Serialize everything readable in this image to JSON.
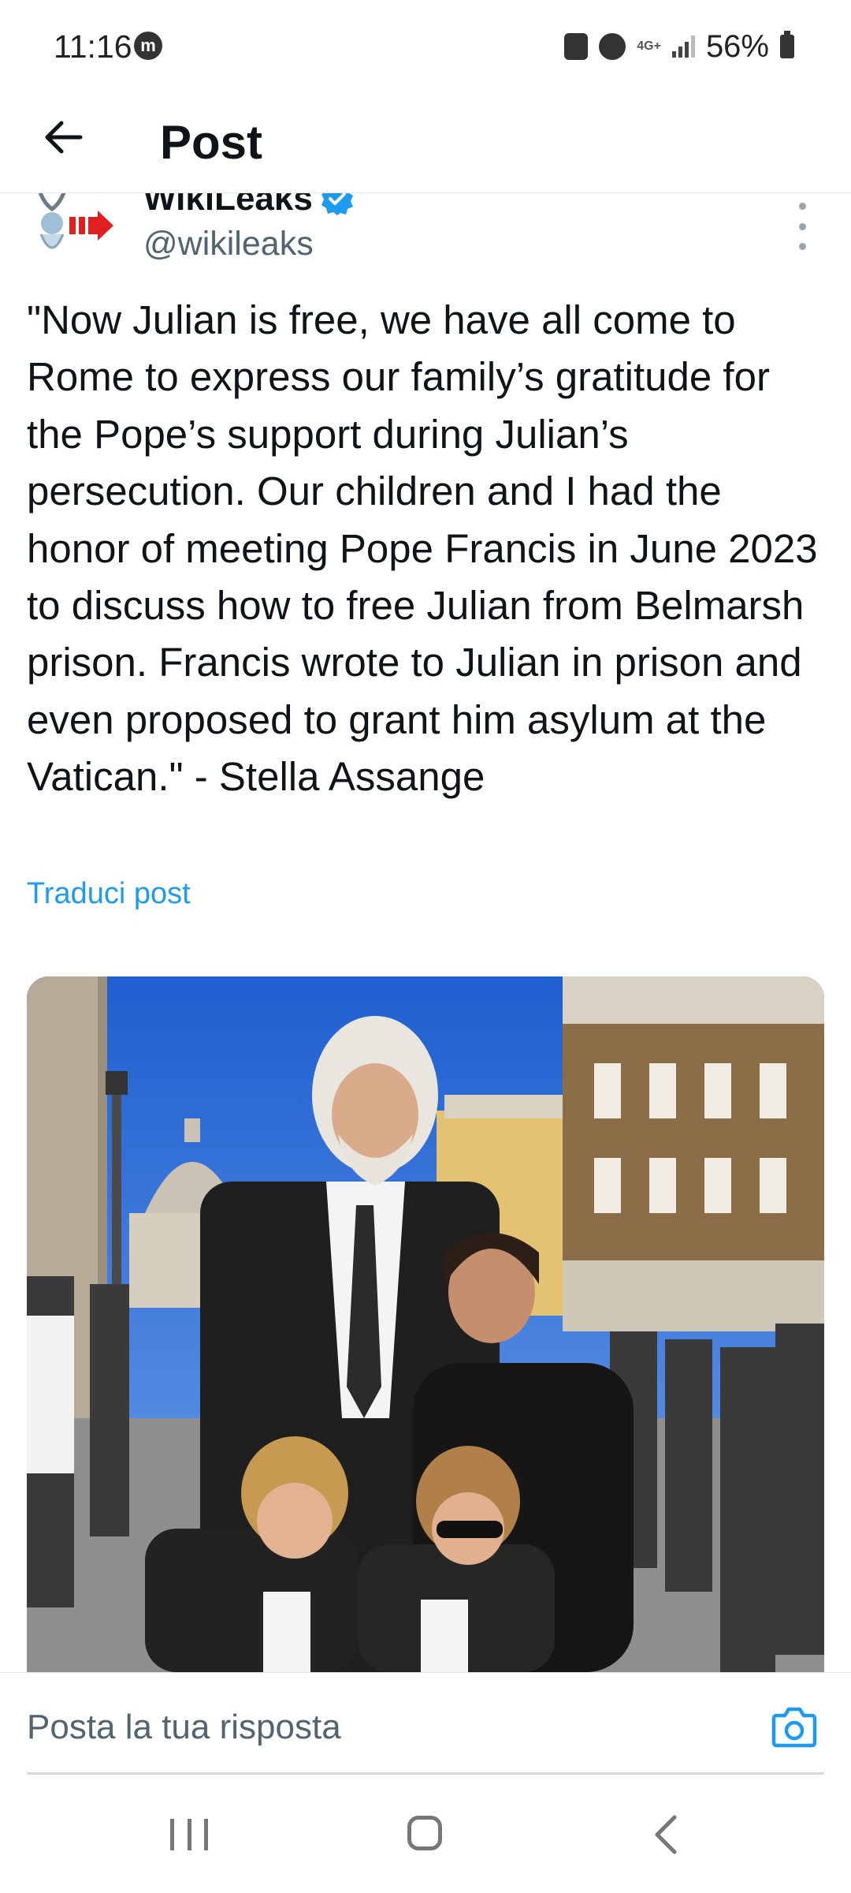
{
  "status_bar": {
    "time": "11:16",
    "network": "4G+",
    "battery": "56%"
  },
  "header": {
    "title": "Post"
  },
  "author": {
    "name": "WikiLeaks",
    "handle": "@wikileaks",
    "verified": true
  },
  "post": {
    "text": "\"Now Julian is free, we have all come to Rome to express our family’s gratitude for the Pope’s support during Julian’s persecution. Our children and I had the honor of meeting Pope Francis in June 2023 to discuss how to free Julian from Belmarsh prison. Francis wrote to Julian in prison and even proposed to grant him asylum at the Vatican.\" - Stella Assange",
    "translate_label": "Traduci post"
  },
  "reply": {
    "placeholder": "Posta la tua risposta"
  },
  "colors": {
    "accent": "#1d9bf0",
    "text_primary": "#0f1419",
    "text_secondary": "#536471"
  }
}
